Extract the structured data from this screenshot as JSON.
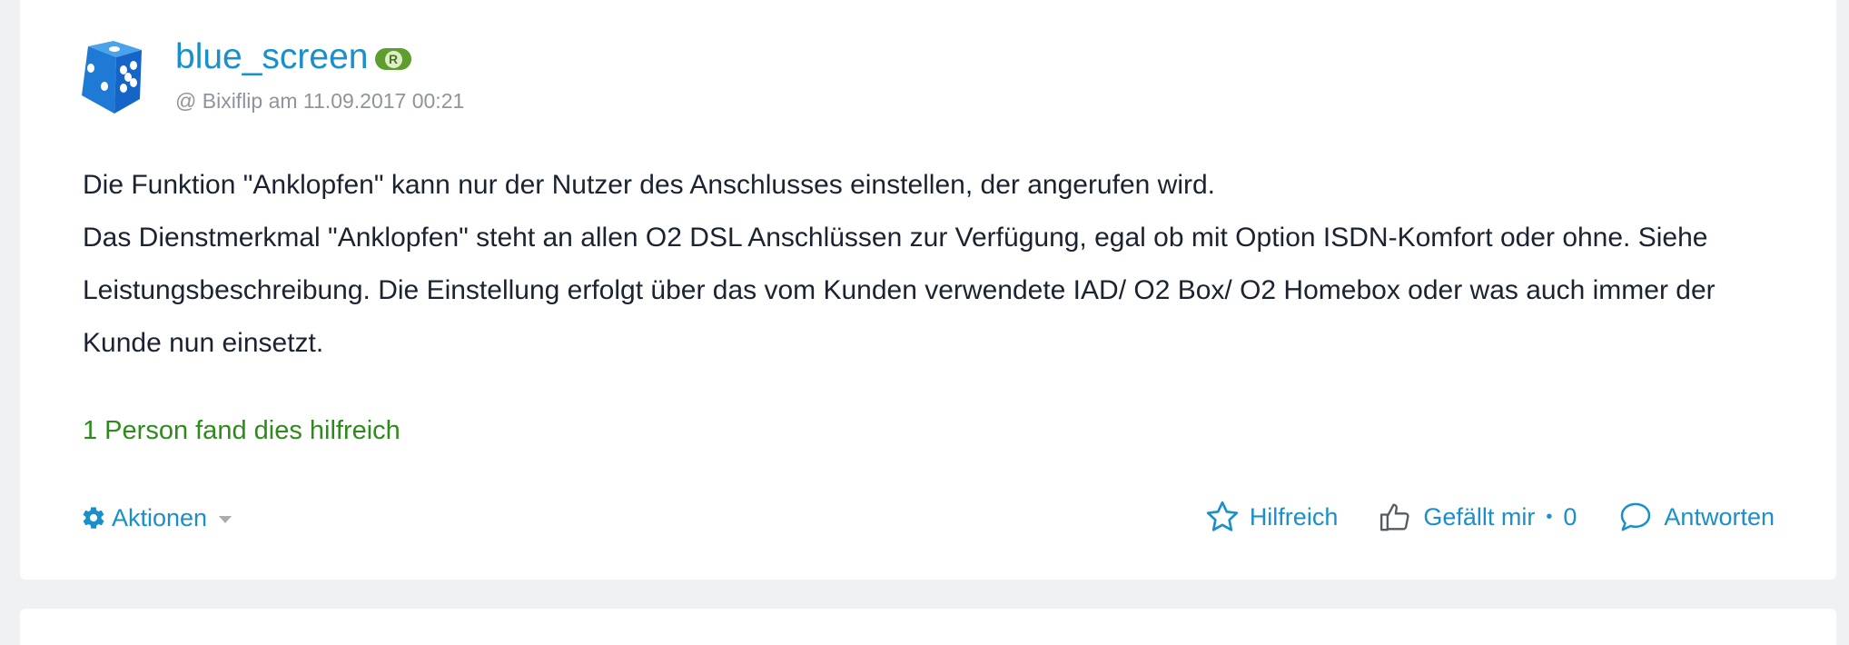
{
  "post": {
    "author": "blue_screen",
    "rank_badge": "R",
    "meta": "@ Bixiflip am 11.09.2017 00:21",
    "paragraphs": [
      "Die Funktion \"Anklopfen\" kann nur der Nutzer des Anschlusses einstellen, der angerufen wird.",
      "Das Dienstmerkmal \"Anklopfen\" steht an allen O2 DSL Anschlüssen zur Verfügung, egal ob mit Option ISDN-Komfort oder ohne. Siehe Leistungsbeschreibung. Die Einstellung erfolgt über das vom Kunden verwendete IAD/ O2 Box/ O2 Homebox oder was auch immer der Kunde nun einsetzt."
    ],
    "helpful_text": "1 Person fand dies hilfreich"
  },
  "toolbar": {
    "actions_label": "Aktionen",
    "helpful_label": "Hilfreich",
    "like_label": "Gefällt mir",
    "like_separator": "•",
    "like_count": "0",
    "reply_label": "Antworten"
  },
  "colors": {
    "link": "#1a8fc9",
    "helpful_green": "#2e8a1d",
    "badge_green": "#5d9e2f",
    "body_text": "#1b2330",
    "meta_text": "#8e949a"
  },
  "icons": {
    "avatar": "dice-icon",
    "actions": "gear-icon",
    "dropdown": "caret-down-icon",
    "helpful": "star-icon",
    "like": "thumbs-up-icon",
    "reply": "speech-bubble-icon"
  }
}
